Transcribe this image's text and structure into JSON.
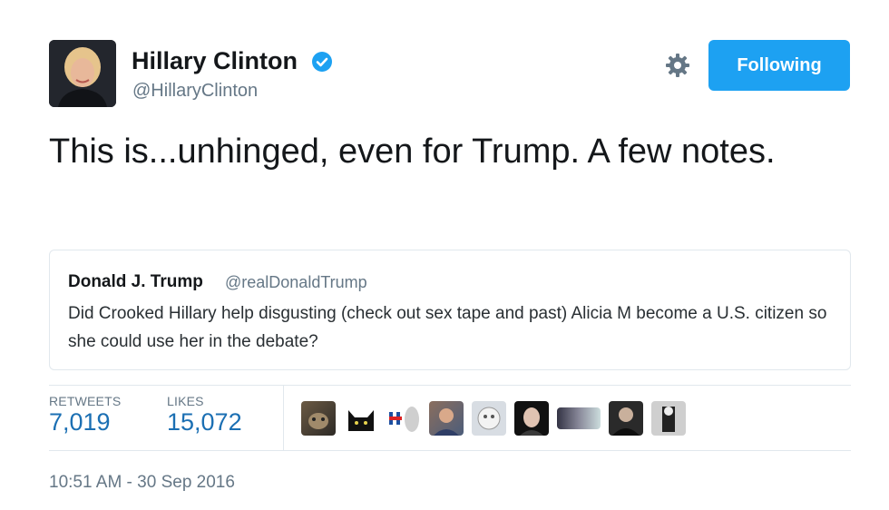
{
  "author": {
    "name": "Hillary Clinton",
    "handle": "@HillaryClinton",
    "verified": true
  },
  "follow_button": {
    "label": "Following",
    "color": "#1da1f2"
  },
  "tweet": {
    "text": "This is...unhinged, even for Trump. A few notes."
  },
  "quoted_tweet": {
    "author_name": "Donald J. Trump",
    "author_handle": "@realDonaldTrump",
    "text": "Did Crooked Hillary help disgusting (check out sex tape and past) Alicia M become a U.S. citizen so she could use her in the debate?"
  },
  "stats": {
    "retweets_label": "RETWEETS",
    "retweets_value": "7,019",
    "likes_label": "LIKES",
    "likes_value": "15,072"
  },
  "liker_avatars": [
    "avatar-dog",
    "avatar-black-cat",
    "avatar-h-logo",
    "avatar-person",
    "avatar-cartoon",
    "avatar-sketch",
    "avatar-woman",
    "avatar-banner",
    "avatar-man-dark",
    "avatar-bw-photo"
  ],
  "timestamp": "10:51 AM - 30 Sep 2016",
  "colors": {
    "accent": "#1da1f2",
    "link": "#1b6fb3",
    "muted": "#657786",
    "border": "#e1e8ed"
  }
}
